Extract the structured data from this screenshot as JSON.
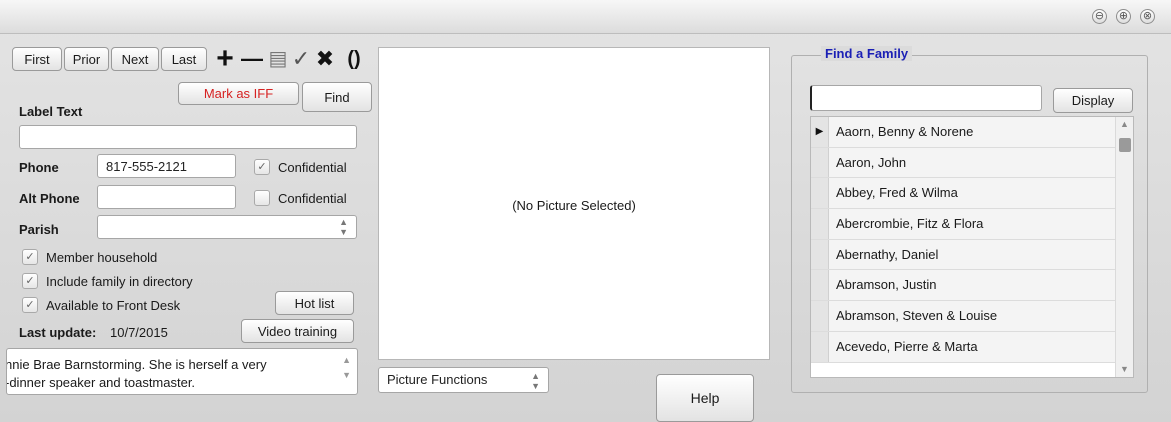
{
  "window": {
    "controls": [
      "⊖",
      "⊕",
      "⊗"
    ]
  },
  "nav": {
    "first": "First",
    "prior": "Prior",
    "next": "Next",
    "last": "Last"
  },
  "toolbar": {
    "add": "+",
    "remove": "—",
    "notes": "▤",
    "check": "✓",
    "cancel": "✖",
    "brackets": "()"
  },
  "form": {
    "mark_iff": "Mark as IFF",
    "find": "Find",
    "label_text_label": "Label Text",
    "label_text_value": "",
    "phone_label": "Phone",
    "phone_value": "817-555-2121",
    "confidential_label": "Confidential",
    "alt_phone_label": "Alt Phone",
    "alt_phone_value": "",
    "parish_label": "Parish",
    "parish_value": "",
    "member_household": "Member household",
    "include_directory": "Include family in directory",
    "front_desk": "Available to Front Desk",
    "hot_list": "Hot list",
    "last_update_label": "Last update:",
    "last_update_value": "10/7/2015",
    "video_training": "Video training",
    "notes_line1": "nnie Brae Barnstorming. She is herself a very",
    "notes_line2": "-dinner speaker and toastmaster.",
    "phone_confidential_checked": true,
    "alt_confidential_checked": false,
    "member_checked": true,
    "include_checked": true,
    "front_desk_checked": true
  },
  "picture": {
    "empty_text": "(No Picture Selected)",
    "functions_label": "Picture Functions"
  },
  "help": "Help",
  "find_family": {
    "title": "Find a Family",
    "search_value": "",
    "display": "Display",
    "rows": [
      "Aaorn, Benny & Norene",
      "Aaron, John",
      "Abbey, Fred & Wilma",
      "Abercrombie, Fitz & Flora",
      "Abernathy, Daniel",
      "Abramson, Justin",
      "Abramson, Steven & Louise",
      "Acevedo, Pierre & Marta"
    ],
    "selected_marker": "▶"
  },
  "colors": {
    "iff_red": "#d62222",
    "group_title_blue": "#1a1fb5"
  }
}
